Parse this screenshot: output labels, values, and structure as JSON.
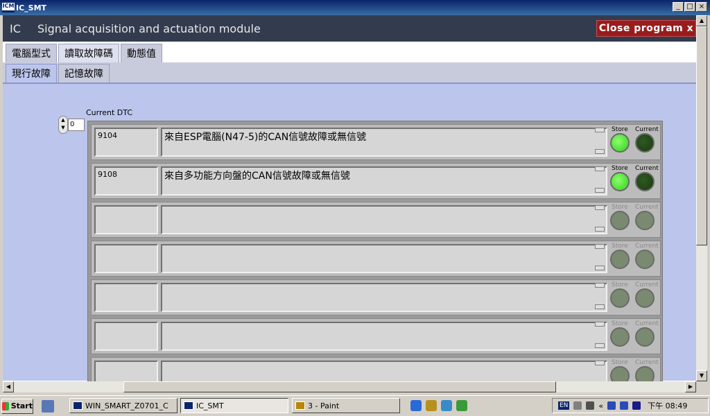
{
  "window": {
    "title": "IC_SMT",
    "app_icon": "ICM"
  },
  "header": {
    "module_code": "IC",
    "module_name": "Signal acquisition and actuation module",
    "close_label": "Close program x"
  },
  "tabs": [
    {
      "label": "電腦型式",
      "active": false
    },
    {
      "label": "讀取故障碼",
      "active": true
    },
    {
      "label": "動態值",
      "active": false
    }
  ],
  "subtabs": [
    {
      "label": "現行故障",
      "active": true
    },
    {
      "label": "記憶故障",
      "active": false
    }
  ],
  "dtc_label": "Current DTC",
  "index_value": "0",
  "led_labels": {
    "store": "Store",
    "current": "Current"
  },
  "led_colors": {
    "on": "#33cc22",
    "dark": "#1a3a10",
    "off": "#7a8a70"
  },
  "dtc_rows": [
    {
      "code": "9104",
      "description": "來自ESP電腦(N47-5)的CAN信號故障或無信號",
      "store_on": true,
      "current_on": false
    },
    {
      "code": "9108",
      "description": "來自多功能方向盤的CAN信號故障或無信號",
      "store_on": true,
      "current_on": false
    },
    {
      "code": "",
      "description": "",
      "store_on": false,
      "current_on": false
    },
    {
      "code": "",
      "description": "",
      "store_on": false,
      "current_on": false
    },
    {
      "code": "",
      "description": "",
      "store_on": false,
      "current_on": false
    },
    {
      "code": "",
      "description": "",
      "store_on": false,
      "current_on": false
    },
    {
      "code": "",
      "description": "",
      "store_on": false,
      "current_on": false
    }
  ],
  "taskbar": {
    "start_label": "Start",
    "tasks": [
      "WIN_SMART_Z0701_C",
      "IC_SMT",
      "3 - Paint"
    ],
    "active_task": 1,
    "lang": "EN",
    "clock": "下午 08:49"
  }
}
